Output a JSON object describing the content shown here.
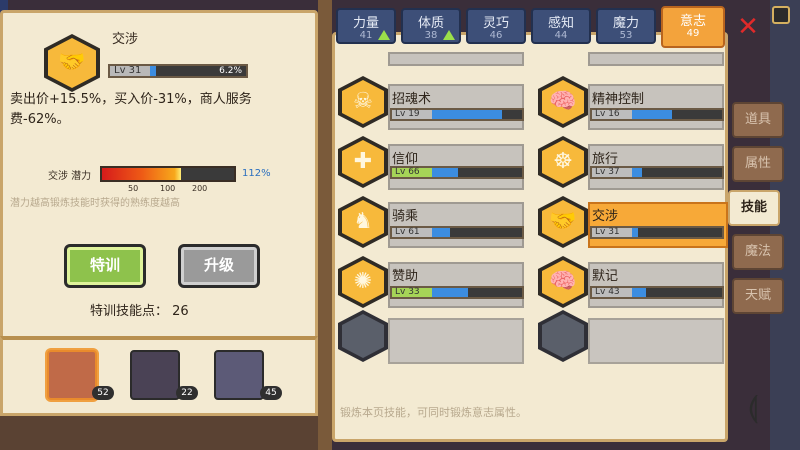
{
  "skill_detail": {
    "name": "交涉",
    "level": "Lv 31",
    "level_progress_pct": "6.2%",
    "level_progress": 0.062,
    "description": "卖出价+15.5%，买入价-31%，商人服务费-62%。",
    "potential_label": "交涉 潜力",
    "potential_pct": "112%",
    "potential_ticks": [
      "50",
      "100",
      "200"
    ],
    "hint": "潜力越高锻炼技能时获得的熟练度越高"
  },
  "actions": {
    "train_label": "特训",
    "upgrade_label": "升级",
    "points_label": "特训技能点：",
    "points_value": "26"
  },
  "heroes": [
    {
      "level": "52"
    },
    {
      "level": "22"
    },
    {
      "level": "45"
    }
  ],
  "attributes": [
    {
      "name": "力量",
      "value": "41",
      "can_upgrade": true
    },
    {
      "name": "体质",
      "value": "38",
      "can_upgrade": true
    },
    {
      "name": "灵巧",
      "value": "46",
      "can_upgrade": false
    },
    {
      "name": "感知",
      "value": "44",
      "can_upgrade": false
    },
    {
      "name": "魔力",
      "value": "53",
      "can_upgrade": false
    },
    {
      "name": "意志",
      "value": "49",
      "can_upgrade": false,
      "active": true
    }
  ],
  "skills": [
    {
      "name": "招魂术",
      "level": "Lv 19",
      "progress": 0.8,
      "icon": "skull-icon"
    },
    {
      "name": "精神控制",
      "level": "Lv 16",
      "progress": 0.45,
      "icon": "brain-icon"
    },
    {
      "name": "信仰",
      "level": "Lv 66",
      "progress": 0.3,
      "icon": "holy-cross-icon",
      "max_green": true
    },
    {
      "name": "旅行",
      "level": "Lv 37",
      "progress": 0.1,
      "icon": "wheel-icon"
    },
    {
      "name": "骑乘",
      "level": "Lv 61",
      "progress": 0.2,
      "icon": "horse-icon"
    },
    {
      "name": "交涉",
      "level": "Lv 31",
      "progress": 0.06,
      "icon": "handshake-icon",
      "selected": true
    },
    {
      "name": "赞助",
      "level": "Lv 33",
      "progress": 0.4,
      "icon": "coins-icon",
      "max_green": true
    },
    {
      "name": "默记",
      "level": "Lv 43",
      "progress": 0.15,
      "icon": "brain-memory-icon"
    }
  ],
  "side_tabs": [
    "道具",
    "属性",
    "技能",
    "魔法",
    "天赋"
  ],
  "active_side_tab": "技能",
  "footer_hint": "锻炼本页技能，可同时锻炼意志属性。",
  "colors": {
    "panel_bg": "#f3ead2",
    "panel_border": "#c9a56a",
    "accent_orange": "#f7a938",
    "progress_blue": "#3c8de0",
    "attr_tab_blue": "#3d4f78",
    "close_red": "#e02a2a"
  }
}
